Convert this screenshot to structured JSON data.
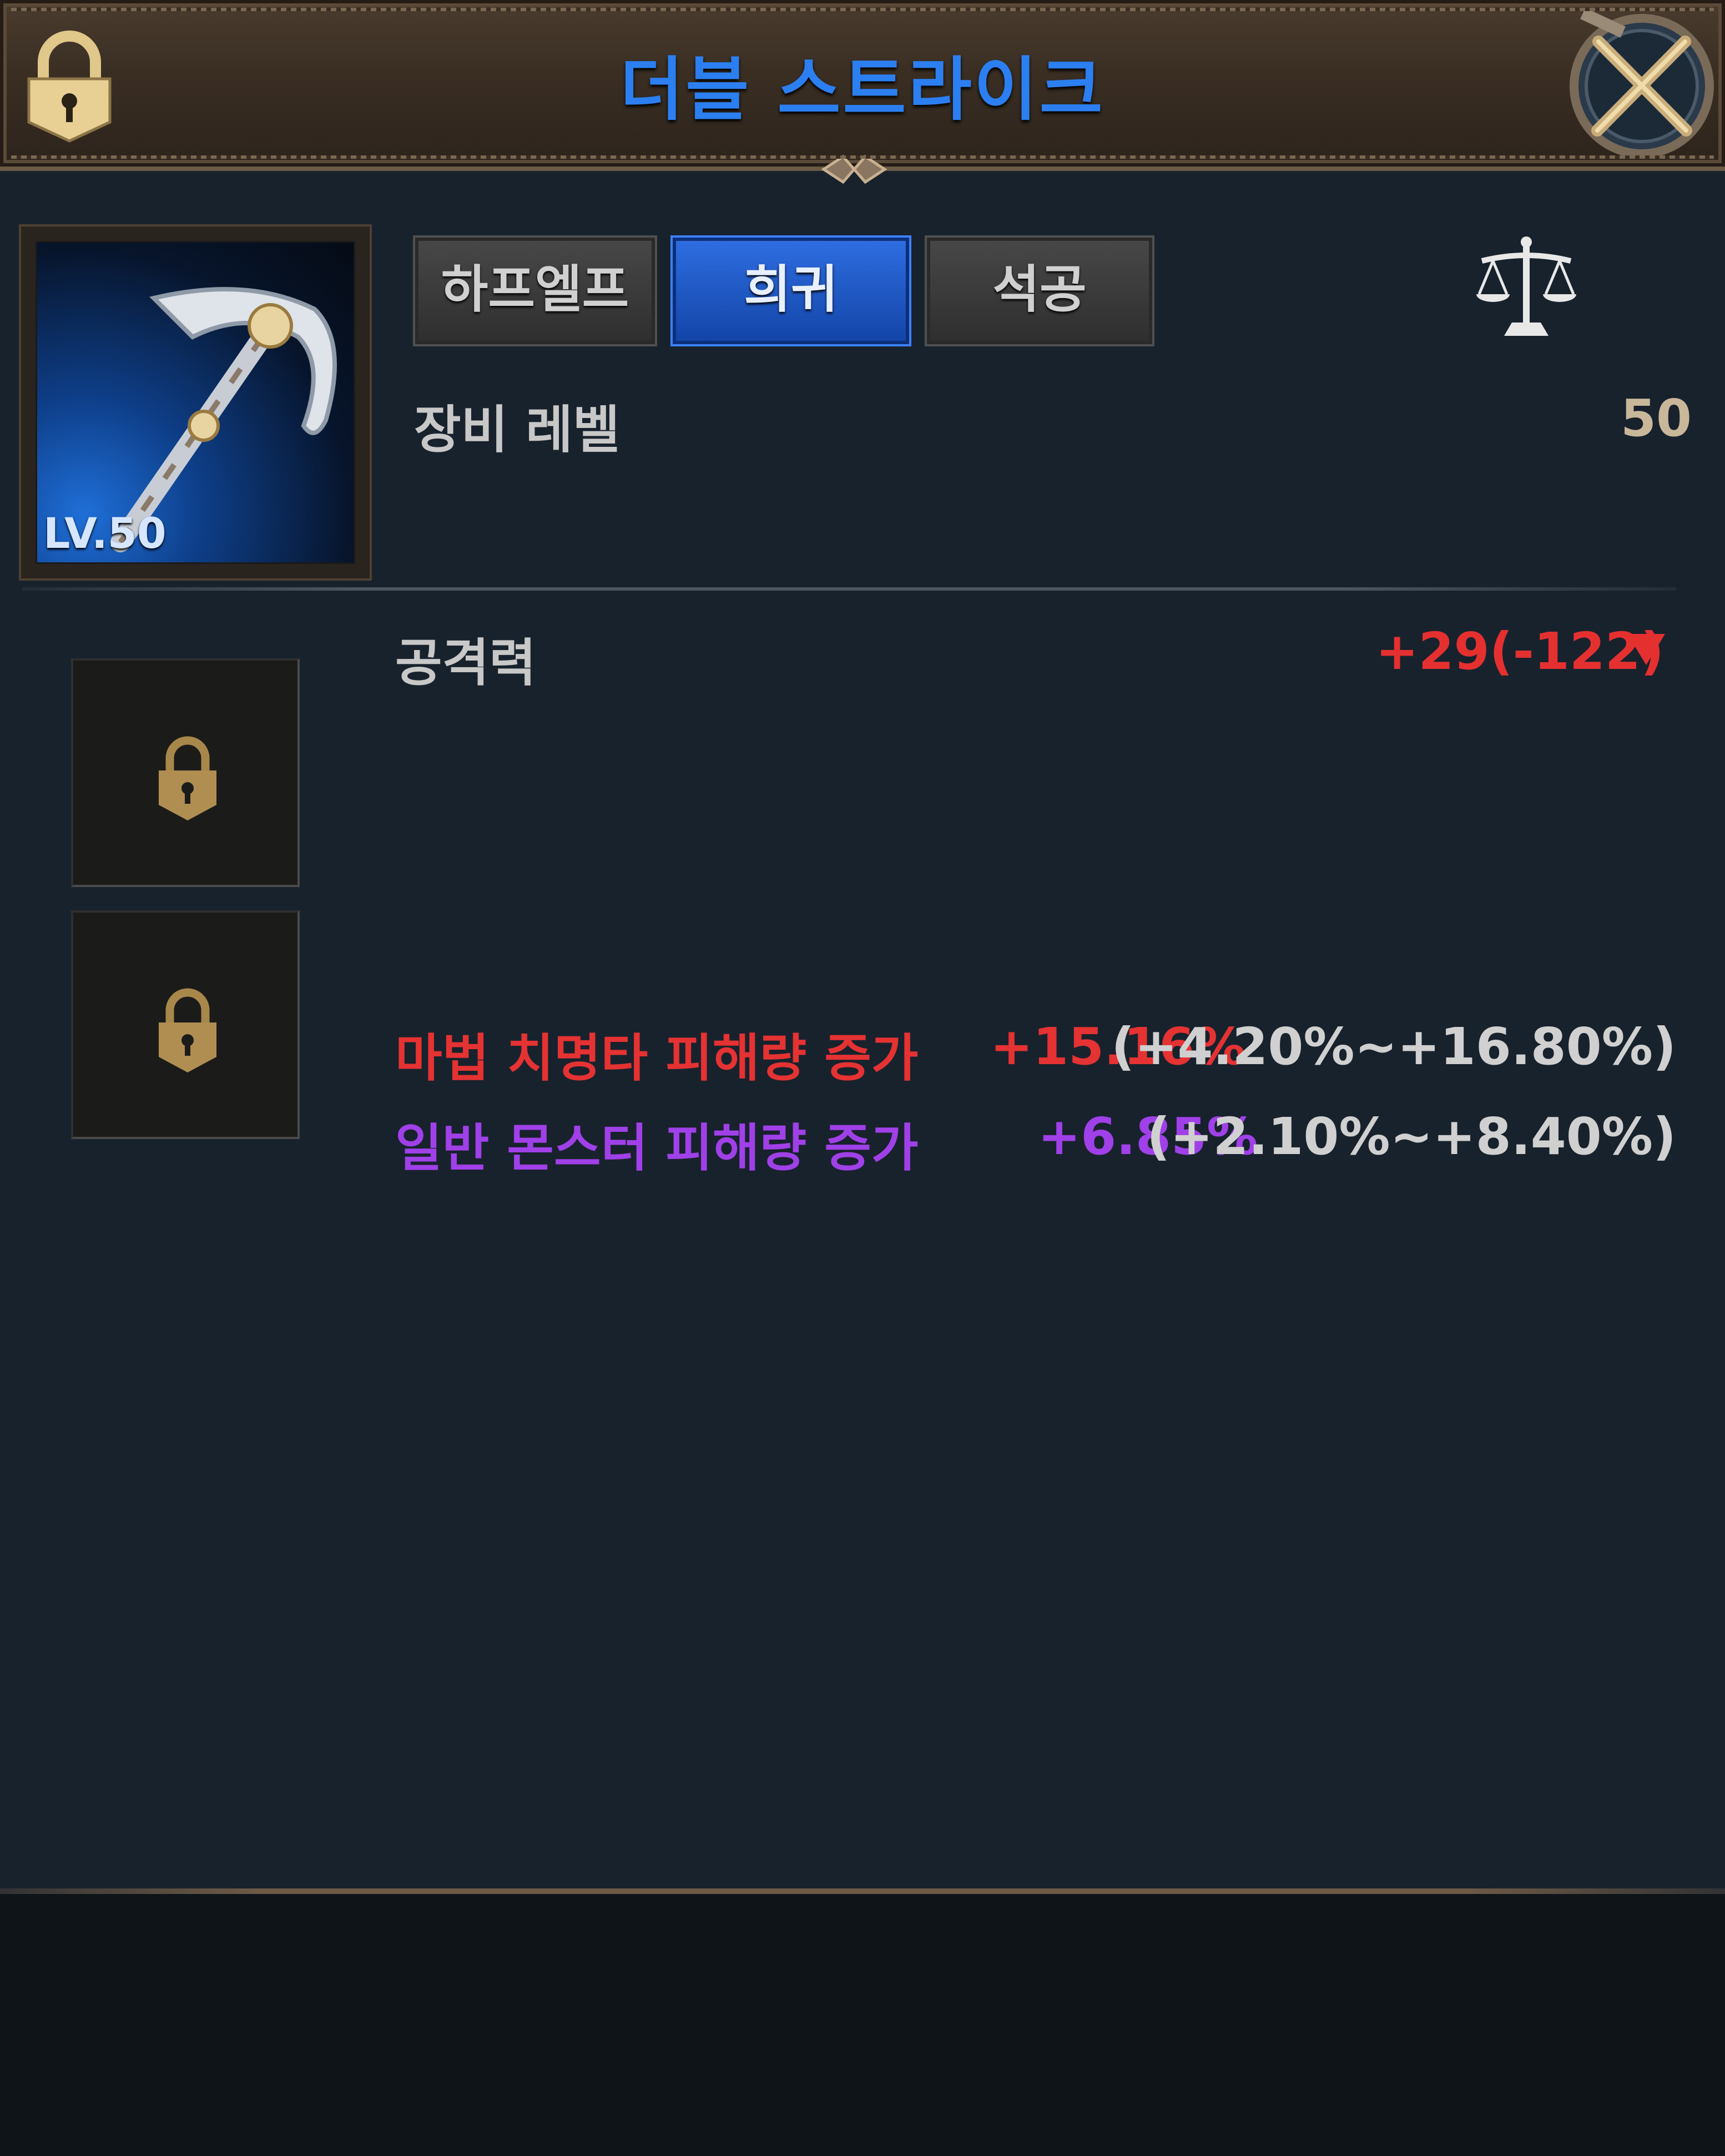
{
  "header": {
    "title": "더블 스트라이크",
    "title_color": "#2c7ff0"
  },
  "icons": {
    "lock": "lock-icon",
    "close": "crossed-swords-close-icon",
    "scale": "balance-scale-icon",
    "item": "pickaxe-weapon-icon"
  },
  "item": {
    "level_text": "LV.50"
  },
  "tabs": [
    {
      "label": "하프엘프",
      "active": false
    },
    {
      "label": "희귀",
      "active": true
    },
    {
      "label": "석공",
      "active": false
    }
  ],
  "stats": {
    "equip_level_label": "장비 레벨",
    "equip_level_value": "50",
    "attack_label": "공격력",
    "attack_value": "+29(-122)",
    "attack_color": "#e53030"
  },
  "options": [
    {
      "label": "마법 치명타 피해량 증가",
      "value": "+15.16%",
      "range": "(+4.20%~+16.80%)",
      "color": "#e53232"
    },
    {
      "label": "일반 몬스터 피해량 증가",
      "value": "+6.85%",
      "range": "(+2.10%~+8.40%)",
      "color": "#a040e8"
    }
  ],
  "slots": [
    {
      "state": "locked"
    },
    {
      "state": "locked"
    }
  ]
}
